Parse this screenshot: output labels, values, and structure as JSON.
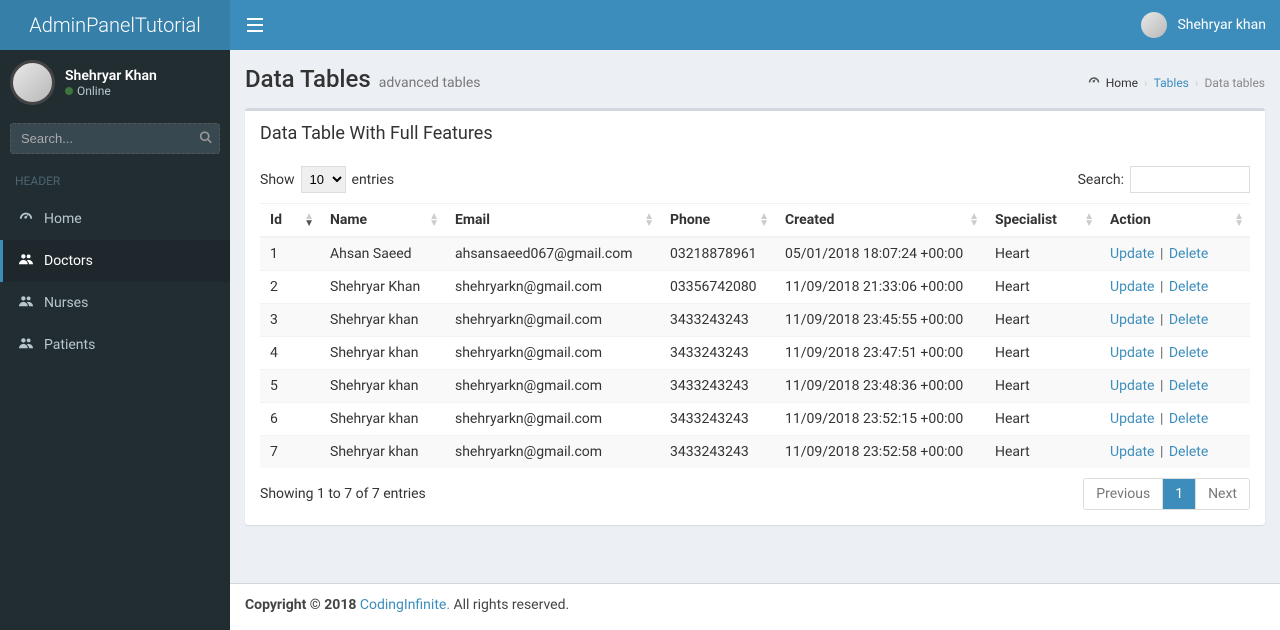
{
  "logo": {
    "bold1": "Admin",
    "bold2": "Panel",
    "light": "Tutorial"
  },
  "top_user_name": "Shehryar khan",
  "sidebar": {
    "user": {
      "name": "Shehryar Khan",
      "status": "Online"
    },
    "search_placeholder": "Search...",
    "header_label": "HEADER",
    "items": [
      {
        "icon": "gauge",
        "label": "Home"
      },
      {
        "icon": "users",
        "label": "Doctors"
      },
      {
        "icon": "users",
        "label": "Nurses"
      },
      {
        "icon": "users",
        "label": "Patients"
      }
    ]
  },
  "page": {
    "title": "Data Tables",
    "subtitle": "advanced tables",
    "breadcrumb": {
      "home": "Home",
      "mid": "Tables",
      "last": "Data tables"
    }
  },
  "box_title": "Data Table With Full Features",
  "table": {
    "length": {
      "prefix": "Show",
      "value": "10",
      "suffix": "entries"
    },
    "search_label": "Search:",
    "columns": [
      "Id",
      "Name",
      "Email",
      "Phone",
      "Created",
      "Specialist",
      "Action"
    ],
    "rows": [
      {
        "id": "1",
        "name": "Ahsan Saeed",
        "email": "ahsansaeed067@gmail.com",
        "phone": "03218878961",
        "created": "05/01/2018 18:07:24 +00:00",
        "specialist": "Heart"
      },
      {
        "id": "2",
        "name": "Shehryar Khan",
        "email": "shehryarkn@gmail.com",
        "phone": "03356742080",
        "created": "11/09/2018 21:33:06 +00:00",
        "specialist": "Heart"
      },
      {
        "id": "3",
        "name": "Shehryar khan",
        "email": "shehryarkn@gmail.com",
        "phone": "3433243243",
        "created": "11/09/2018 23:45:55 +00:00",
        "specialist": "Heart"
      },
      {
        "id": "4",
        "name": "Shehryar khan",
        "email": "shehryarkn@gmail.com",
        "phone": "3433243243",
        "created": "11/09/2018 23:47:51 +00:00",
        "specialist": "Heart"
      },
      {
        "id": "5",
        "name": "Shehryar khan",
        "email": "shehryarkn@gmail.com",
        "phone": "3433243243",
        "created": "11/09/2018 23:48:36 +00:00",
        "specialist": "Heart"
      },
      {
        "id": "6",
        "name": "Shehryar khan",
        "email": "shehryarkn@gmail.com",
        "phone": "3433243243",
        "created": "11/09/2018 23:52:15 +00:00",
        "specialist": "Heart"
      },
      {
        "id": "7",
        "name": "Shehryar khan",
        "email": "shehryarkn@gmail.com",
        "phone": "3433243243",
        "created": "11/09/2018 23:52:58 +00:00",
        "specialist": "Heart"
      }
    ],
    "action": {
      "update": "Update",
      "delete": "Delete"
    },
    "info": "Showing 1 to 7 of 7 entries",
    "pagination": {
      "prev": "Previous",
      "page": "1",
      "next": "Next"
    }
  },
  "footer": {
    "copyright": "Copyright © 2018 ",
    "brand": "CodingInfinite.",
    "rest": " All rights reserved."
  }
}
